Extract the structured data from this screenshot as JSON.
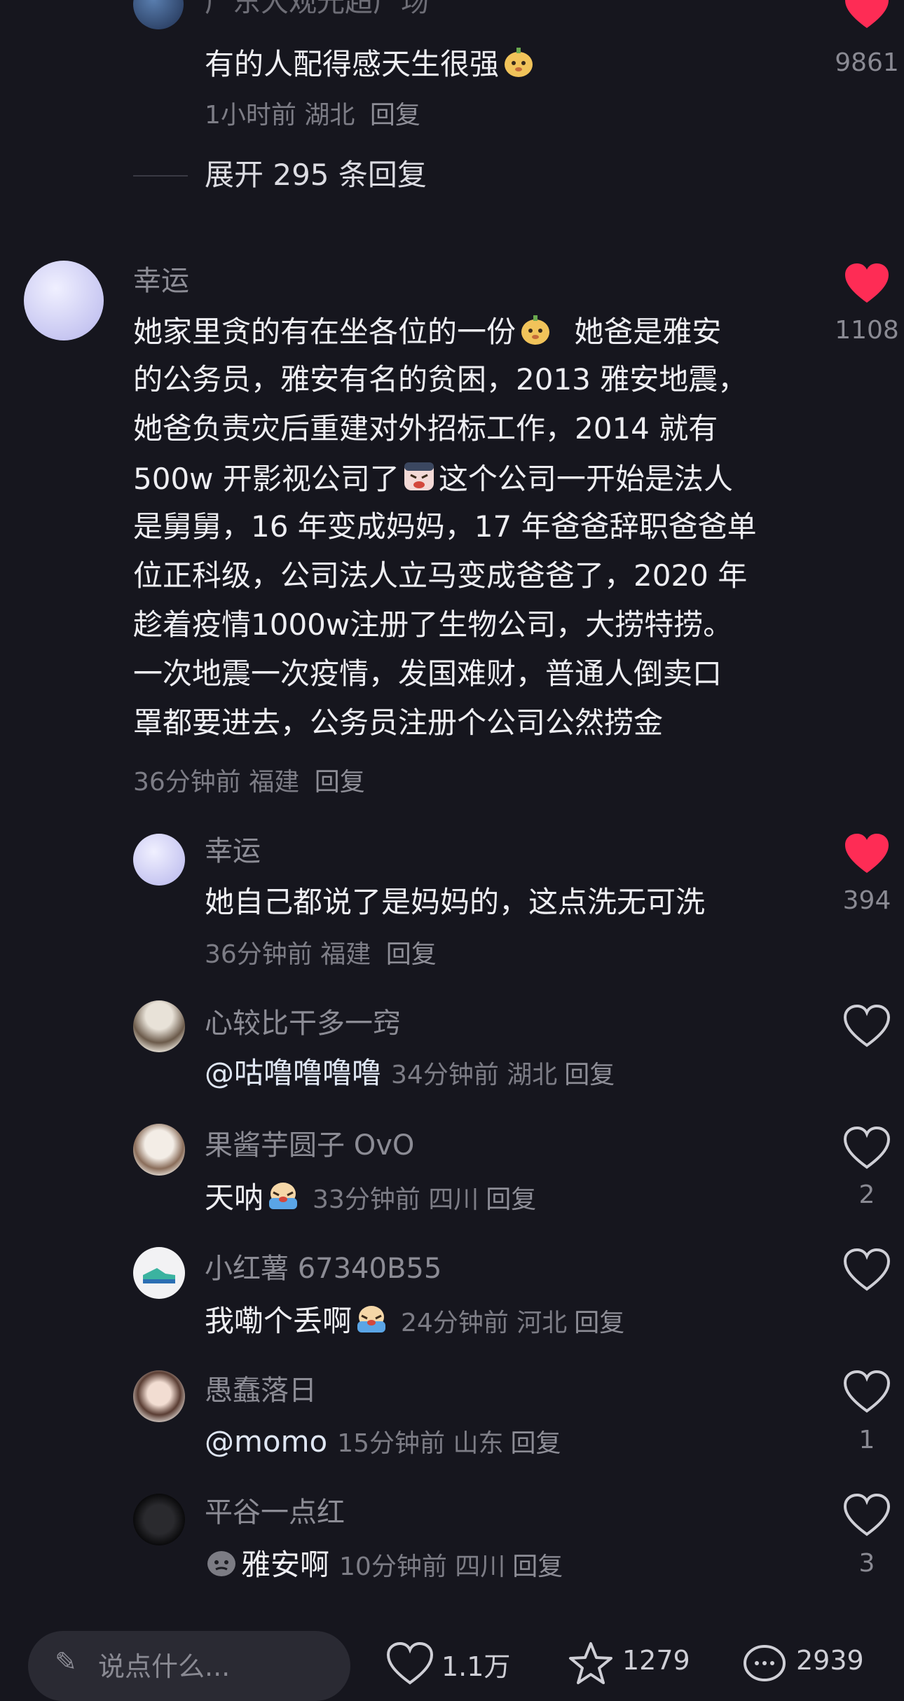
{
  "top_comment": {
    "username_partial": "广东大观光超广场",
    "text": "有的人配得感天生很强",
    "emoji": "pear-face-emoji",
    "time": "1小时前",
    "location": "湖北",
    "reply": "回复",
    "likes": "9861",
    "expand_replies": "展开 295 条回复"
  },
  "main_comment": {
    "username": "幸运",
    "lines": [
      "她家里贪的有在坐各位的一份",
      "她爸是雅安",
      "的公务员，雅安有名的贫困，2013 雅安地震，",
      "她爸负责灾后重建对外招标工作，2014 就有",
      "500w 开影视公司了",
      "这个公司一开始是法人",
      "是舅舅，16 年变成妈妈，17 年爸爸辞职爸爸单",
      "位正科级，公司法人立马变成爸爸了，2020 年",
      "趁着疫情1000w注册了生物公司，大捞特捞。",
      "一次地震一次疫情，发国难财，普通人倒卖口",
      "罩都要进去，公务员注册个公司公然捞金"
    ],
    "time": "36分钟前",
    "location": "福建",
    "reply": "回复",
    "likes": "1108"
  },
  "replies": [
    {
      "username": "幸运",
      "text": "她自己都说了是妈妈的，这点洗无可洗",
      "time": "36分钟前",
      "location": "福建",
      "reply": "回复",
      "likes": "394",
      "liked": true
    },
    {
      "username": "心较比干多一窍",
      "text": "@咕噜噜噜噜",
      "time": "34分钟前",
      "location": "湖北",
      "reply": "回复",
      "likes": "",
      "liked": false
    },
    {
      "username": "果酱芋圆子 OvO",
      "text": "天呐",
      "time": "33分钟前",
      "location": "四川",
      "reply": "回复",
      "likes": "2",
      "liked": false
    },
    {
      "username": "小红薯 67340B55",
      "text": "我嘞个丢啊",
      "time": "24分钟前",
      "location": "河北",
      "reply": "回复",
      "likes": "",
      "liked": false
    },
    {
      "username": "愚蠢落日",
      "text": "@momo",
      "time": "15分钟前",
      "location": "山东",
      "reply": "回复",
      "likes": "1",
      "liked": false
    },
    {
      "username": "平谷一点红",
      "text": "雅安啊",
      "time": "10分钟前",
      "location": "四川",
      "reply": "回复",
      "likes": "3",
      "liked": false
    }
  ],
  "bottom_bar": {
    "input_placeholder": "说点什么...",
    "likes": "1.1万",
    "favorites": "1279",
    "comments": "2939"
  },
  "colors": {
    "heart_red": "#fe2c55",
    "background": "#16161e"
  }
}
